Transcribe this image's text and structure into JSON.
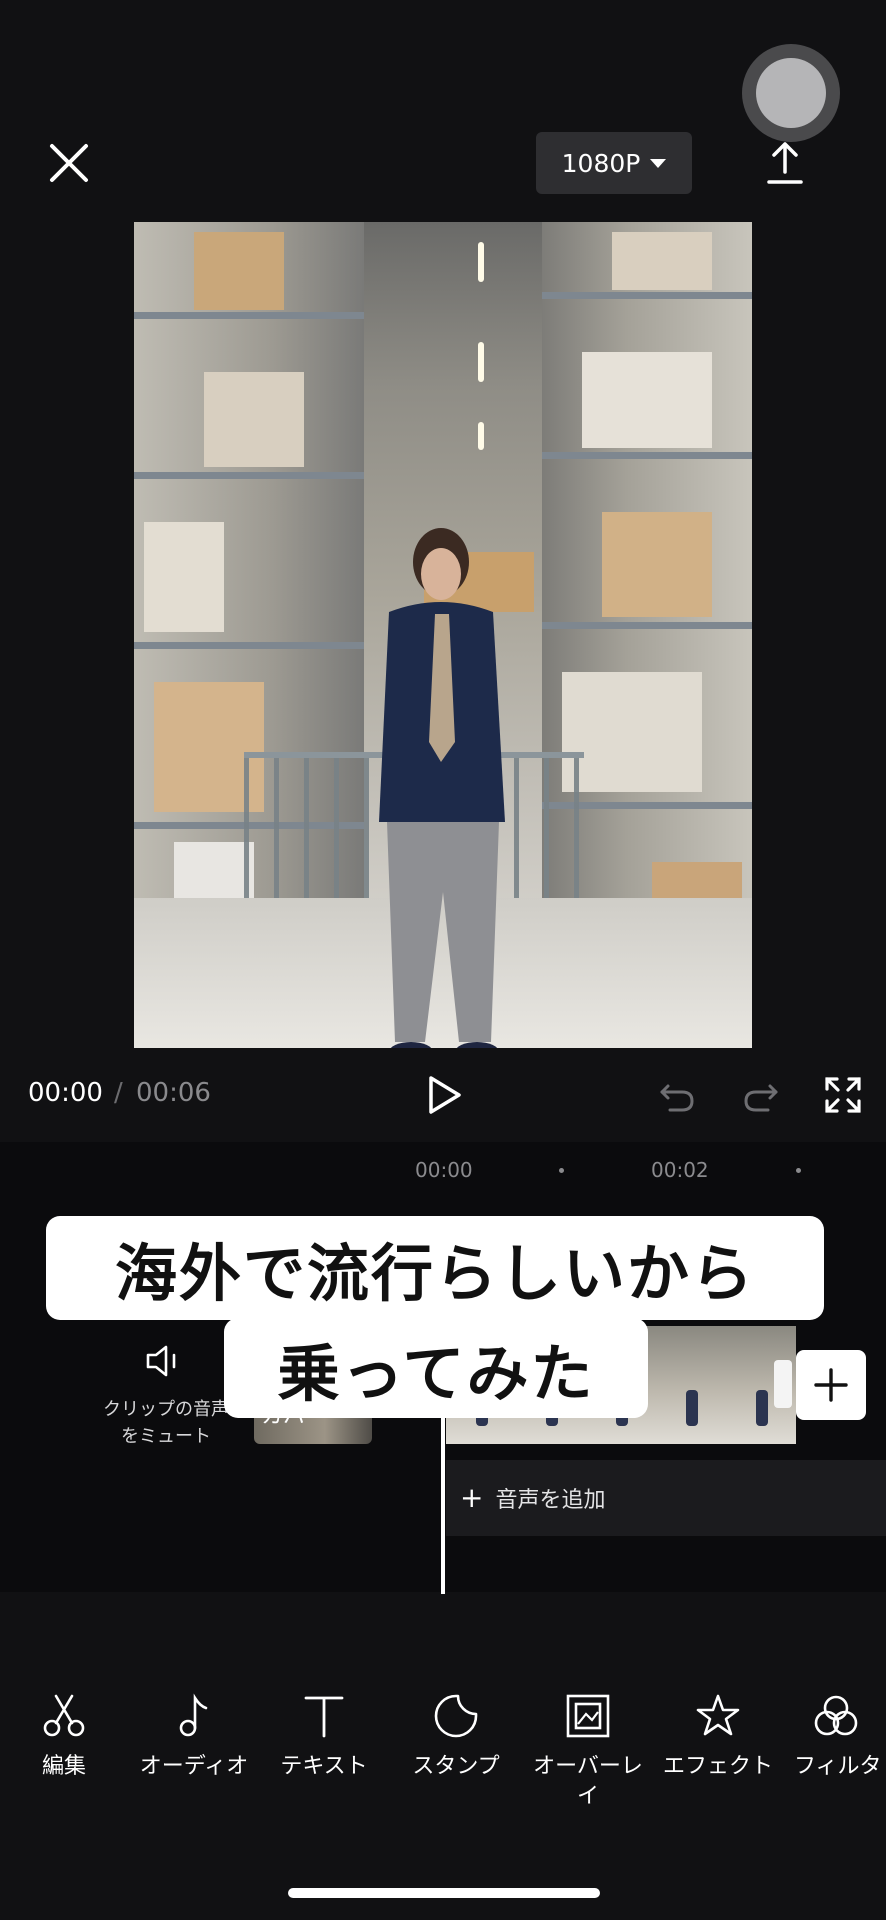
{
  "header": {
    "resolution": "1080P",
    "close_icon": "close-icon",
    "export_icon": "upload-icon",
    "record_icon": "record-icon"
  },
  "playback": {
    "current_time": "00:00",
    "separator": "/",
    "total_time": "00:06",
    "play_icon": "play-icon",
    "undo_icon": "undo-icon",
    "redo_icon": "redo-icon",
    "fullscreen_icon": "fullscreen-icon"
  },
  "timeline": {
    "ticks": [
      "00:00",
      "00:02"
    ],
    "mute_label": "クリップの音声をミュート",
    "cover_label": "カバー",
    "add_audio_label": "音声を追加",
    "add_audio_icon": "+"
  },
  "caption": {
    "line1": "海外で流行らしいから",
    "line2": "乗ってみた"
  },
  "toolbar": {
    "items": [
      {
        "label": "編集",
        "icon": "scissors-icon"
      },
      {
        "label": "オーディオ",
        "icon": "music-note-icon"
      },
      {
        "label": "テキスト",
        "icon": "text-icon"
      },
      {
        "label": "スタンプ",
        "icon": "sticker-icon"
      },
      {
        "label": "オーバーレイ",
        "icon": "overlay-icon"
      },
      {
        "label": "エフェクト",
        "icon": "effect-star-icon"
      },
      {
        "label": "フィルタ",
        "icon": "filter-icon"
      }
    ]
  },
  "colors": {
    "background": "#111113",
    "timeline_background": "#0b0b0d",
    "accent_white": "#ffffff"
  }
}
